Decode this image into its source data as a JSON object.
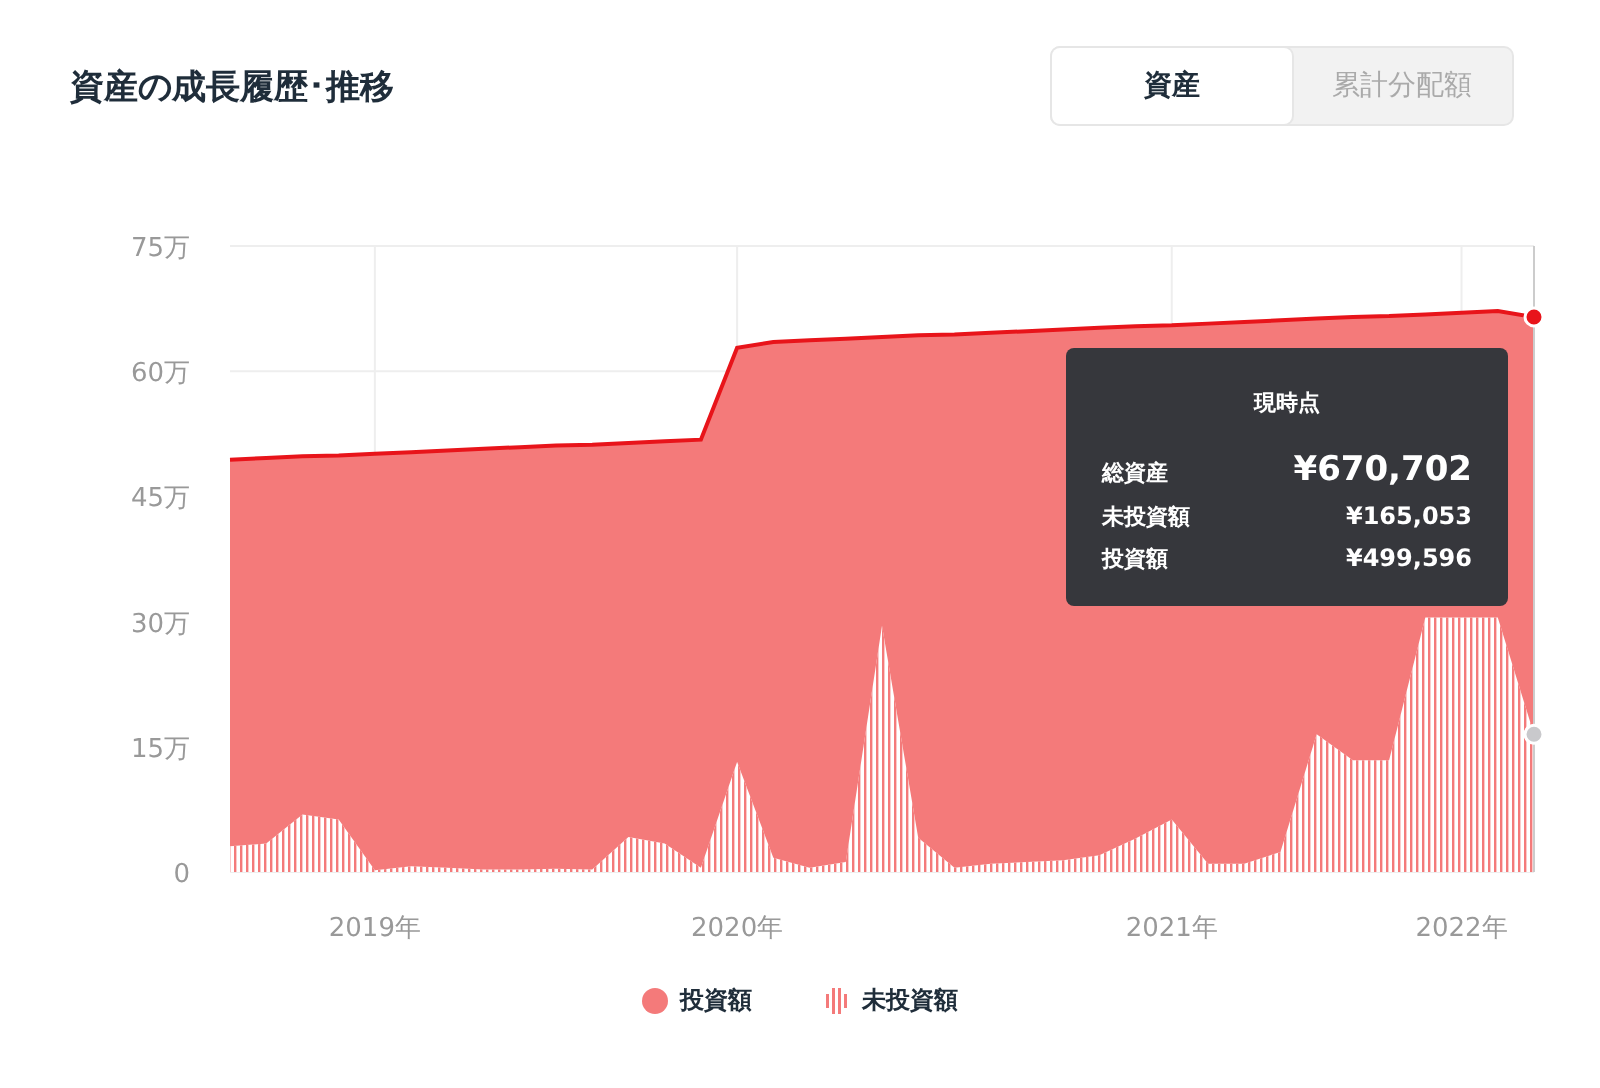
{
  "header": {
    "title": "資産の成長履歴･推移"
  },
  "tabs": [
    {
      "label": "資産",
      "selected": true
    },
    {
      "label": "累計分配額",
      "selected": false
    }
  ],
  "chart": {
    "legend_items": [
      {
        "kind": "solid"
      },
      {
        "kind": "hatch"
      }
    ],
    "chart_data": {
      "type": "area",
      "stacked": true,
      "grid": true,
      "categories": [
        null,
        null,
        null,
        null,
        "2019年",
        null,
        null,
        null,
        null,
        null,
        null,
        null,
        null,
        null,
        "2020年",
        null,
        null,
        null,
        null,
        null,
        null,
        null,
        null,
        null,
        null,
        null,
        "2021年",
        null,
        null,
        null,
        null,
        null,
        null,
        null,
        "2022年",
        null,
        null
      ],
      "series": [
        {
          "name": "投資額",
          "color": "#f47a7a",
          "values": [
            46.3,
            46.2,
            42.9,
            43.6,
            49.9,
            49.6,
            50.0,
            50.4,
            50.6,
            50.7,
            50.9,
            47.2,
            48.2,
            51.3,
            49.6,
            61.8,
            63.2,
            62.7,
            34.6,
            60.2,
            63.9,
            63.6,
            63.6,
            63.6,
            63.2,
            61.4,
            59.2,
            64.7,
            64.9,
            63.7,
            49.8,
            53.1,
            53.2,
            36.3,
            36.5,
            36.7,
            50.0
          ]
        },
        {
          "name": "未投資額",
          "color": "#f47a7a",
          "values": [
            3.1,
            3.4,
            6.9,
            6.3,
            0.2,
            0.7,
            0.5,
            0.3,
            0.3,
            0.4,
            0.3,
            4.2,
            3.4,
            0.5,
            13.2,
            1.7,
            0.5,
            1.2,
            29.5,
            4.1,
            0.5,
            1.0,
            1.2,
            1.4,
            2.0,
            4.0,
            6.3,
            1.0,
            1.0,
            2.4,
            16.5,
            13.4,
            13.4,
            30.5,
            30.5,
            30.5,
            16.5
          ]
        }
      ],
      "ylim": [
        0,
        75
      ],
      "yticks": [
        {
          "value": 0,
          "label": "0"
        },
        {
          "value": 15,
          "label": "15万"
        },
        {
          "value": 30,
          "label": "30万"
        },
        {
          "value": 45,
          "label": "45万"
        },
        {
          "value": 60,
          "label": "60万"
        },
        {
          "value": 75,
          "label": "75万"
        }
      ]
    },
    "tooltip": {
      "title": "現時点",
      "rows": [
        {
          "label": "総資産",
          "value": "¥670,702",
          "emphasis": true
        },
        {
          "label": "未投資額",
          "value": "¥165,053",
          "emphasis": false
        },
        {
          "label": "投資額",
          "value": "¥499,596",
          "emphasis": false
        }
      ]
    }
  }
}
